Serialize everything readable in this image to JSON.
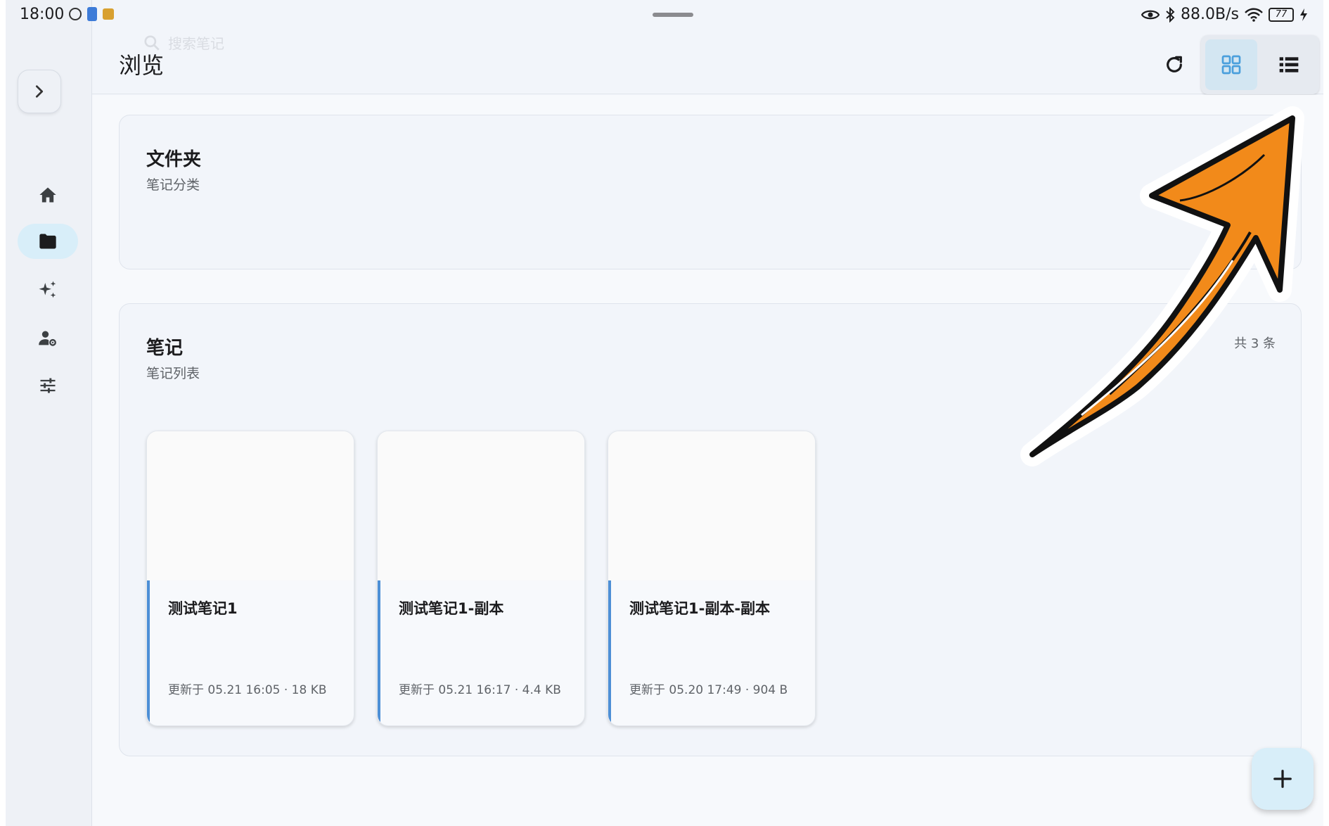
{
  "status_bar": {
    "time": "18:00",
    "net_speed": "88.0B/s",
    "battery": "77"
  },
  "header": {
    "search_placeholder": "搜索笔记",
    "title": "浏览"
  },
  "folders_section": {
    "title": "文件夹",
    "subtitle": "笔记分类"
  },
  "notes_section": {
    "title": "笔记",
    "subtitle": "笔记列表",
    "count": "共 3 条",
    "notes": [
      {
        "title": "测试笔记1",
        "meta": "更新于 05.21 16:05 · 18 KB"
      },
      {
        "title": "测试笔记1-副本",
        "meta": "更新于 05.21 16:17 · 4.4 KB"
      },
      {
        "title": "测试笔记1-副本-副本",
        "meta": "更新于 05.20 17:49 · 904 B"
      }
    ]
  },
  "colors": {
    "accent": "#4d8fd6",
    "active_nav": "#d8eef9",
    "arrow": "#f28a1a"
  }
}
